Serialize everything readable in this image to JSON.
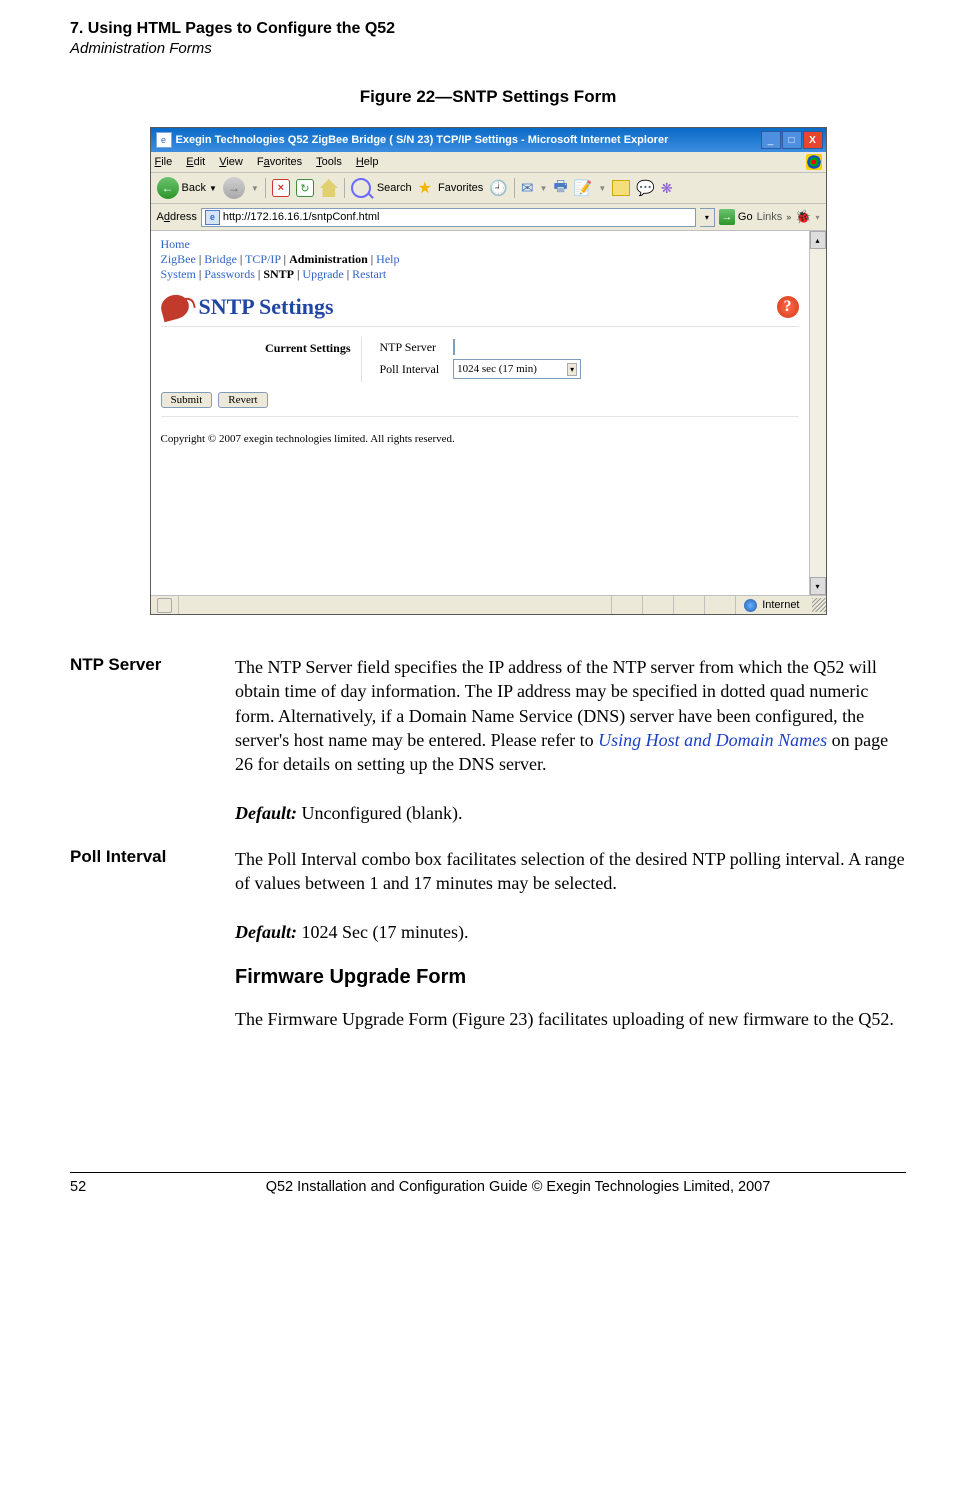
{
  "header": {
    "chapter": "7. Using HTML Pages to Configure the Q52",
    "section": "Administration Forms"
  },
  "figure_caption": "Figure 22—SNTP Settings Form",
  "ie": {
    "titlebar": "Exegin Technologies Q52 ZigBee Bridge ( S/N 23) TCP/IP Settings - Microsoft Internet Explorer",
    "menus": {
      "file": "File",
      "edit": "Edit",
      "view": "View",
      "favorites": "Favorites",
      "tools": "Tools",
      "help": "Help"
    },
    "toolbar": {
      "back": "Back",
      "search": "Search",
      "favorites": "Favorites"
    },
    "address_label": "Address",
    "url": "http://172.16.16.1/sntpConf.html",
    "go": "Go",
    "links": "Links",
    "nav1": {
      "home": "Home",
      "zigbee": "ZigBee",
      "bridge": "Bridge",
      "tcpip": "TCP/IP",
      "admin": "Administration",
      "help": "Help"
    },
    "nav2": {
      "system": "System",
      "passwords": "Passwords",
      "sntp": "SNTP",
      "upgrade": "Upgrade",
      "restart": "Restart"
    },
    "page_title": "SNTP Settings",
    "current_settings": "Current Settings",
    "ntp_label": "NTP Server",
    "ntp_value": "",
    "poll_label": "Poll Interval",
    "poll_value": "1024 sec (17 min)",
    "submit": "Submit",
    "revert": "Revert",
    "copyright": "Copyright © 2007 exegin technologies limited. All rights reserved.",
    "status_inet": "Internet"
  },
  "defs": {
    "ntp": {
      "term": "NTP Server",
      "body_a": "The NTP Server field specifies the IP address of the NTP server from which the Q52 will obtain time of day information. The IP address may be specified in dotted quad numeric form. Alternatively, if a Domain Name Service (DNS) server have been configured, the server's host name may be entered. Please refer to ",
      "link": "Using Host and Domain Names",
      "body_b": " on page 26 for details on setting up the DNS server.",
      "dflt_label": "Default:",
      "dflt_val": " Unconfigured (blank)."
    },
    "poll": {
      "term": "Poll Interval",
      "body": "The Poll Interval combo box facilitates selection of the desired NTP polling interval. A range of values between 1 and 17 minutes may be selected.",
      "dflt_label": "Default:",
      "dflt_val": " 1024 Sec (17 minutes)."
    }
  },
  "h2": "Firmware Upgrade Form",
  "para_a": "The Firmware Upgrade Form (",
  "figref": "Figure 23",
  "para_b": ") facilitates uploading of new firmware to the Q52.",
  "footer": {
    "page": "52",
    "text": "Q52 Installation and Configuration Guide  © Exegin Technologies Limited, 2007"
  }
}
